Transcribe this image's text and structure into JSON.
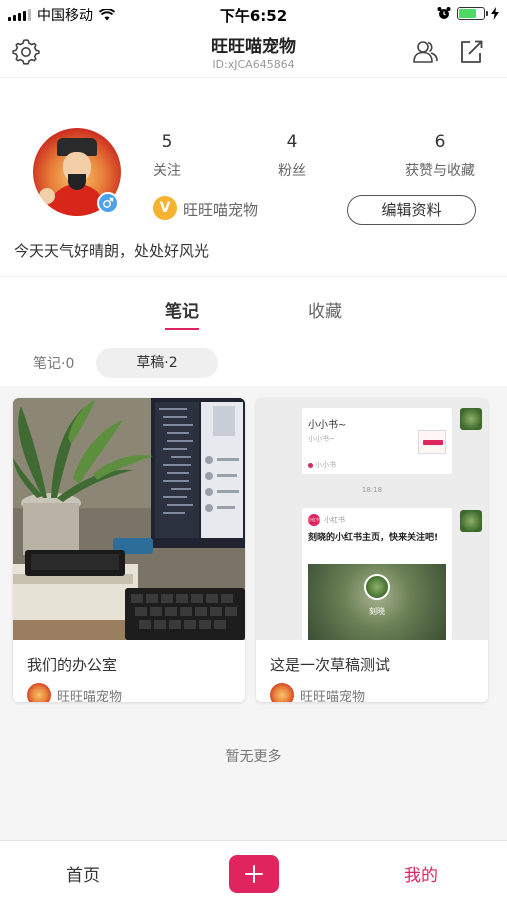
{
  "status_bar": {
    "carrier": "中国移动",
    "time": "下午6:52"
  },
  "nav": {
    "title": "旺旺喵宠物",
    "subtitle": "ID:xJCA645864"
  },
  "profile": {
    "stats": [
      {
        "value": "5",
        "label": "关注"
      },
      {
        "value": "4",
        "label": "粉丝"
      },
      {
        "value": "6",
        "label": "获赞与收藏"
      }
    ],
    "verified_badge": "V",
    "name": "旺旺喵宠物",
    "edit_button": "编辑资料",
    "bio": "今天天气好晴朗，处处好风光"
  },
  "tabs": {
    "notes": "笔记",
    "collect": "收藏"
  },
  "filters": {
    "notes": "笔记·0",
    "drafts": "草稿·2"
  },
  "cards": [
    {
      "title": "我们的办公室",
      "author": "旺旺喵宠物"
    },
    {
      "title": "这是一次草稿测试",
      "author": "旺旺喵宠物"
    }
  ],
  "preview": {
    "top_title": "小小书~",
    "top_sub": "小小书~",
    "top_footer": "小小书",
    "time": "18:18",
    "brand": "小红书",
    "message": "刻晓的小红书主页，快来关注吧!",
    "photo_name": "刻晓",
    "red_badge": "小红书"
  },
  "no_more": "暂无更多",
  "tabbar": {
    "home": "首页",
    "mine": "我的"
  },
  "colors": {
    "accent": "#e0245e",
    "verified": "#f5b330",
    "gender": "#4aa3e8"
  }
}
